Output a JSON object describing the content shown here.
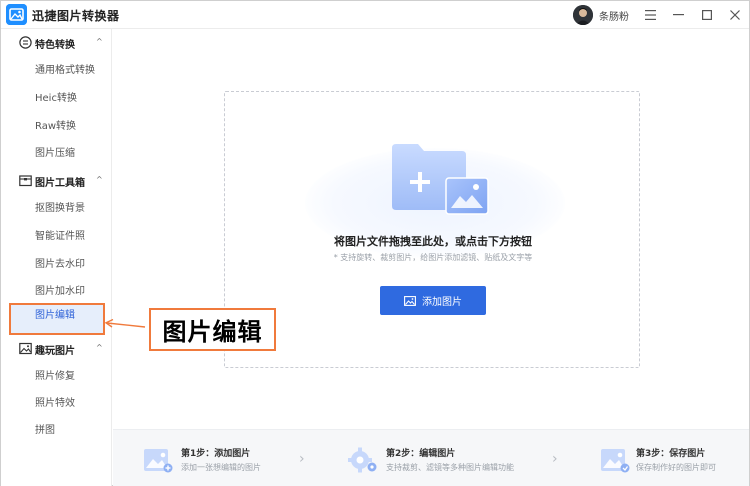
{
  "app": {
    "title": "迅捷图片转换器",
    "username": "条肠粉"
  },
  "window_controls": {
    "menu": "☰",
    "minimize": "—",
    "maximize": "☐",
    "close": "✕"
  },
  "sidebar": {
    "groups": [
      {
        "label": "特色转换",
        "icon": "swap-icon",
        "items": [
          "通用格式转换",
          "Heic转换",
          "Raw转换",
          "图片压缩"
        ]
      },
      {
        "label": "图片工具箱",
        "icon": "toolbox-icon",
        "items": [
          "抠图换背景",
          "智能证件照",
          "图片去水印",
          "图片加水印",
          "图片编辑"
        ]
      },
      {
        "label": "趣玩图片",
        "icon": "image-icon",
        "items": [
          "照片修复",
          "照片特效",
          "拼图"
        ]
      }
    ],
    "active_item": "图片编辑"
  },
  "dropzone": {
    "title": "将图片文件拖拽至此处，或点击下方按钮",
    "subtitle": "* 支持旋转、裁剪图片，给图片添加滤镜、贴纸及文字等",
    "button_label": "添加图片"
  },
  "steps": [
    {
      "title": "第1步：添加图片",
      "desc": "添加一张想编辑的图片"
    },
    {
      "title": "第2步：编辑图片",
      "desc": "支持裁剪、滤镜等多种图片编辑功能"
    },
    {
      "title": "第3步：保存图片",
      "desc": "保存制作好的图片即可"
    }
  ],
  "annotation": {
    "label": "图片编辑"
  },
  "colors": {
    "accent": "#2f6ae0",
    "highlight": "#f07a3c",
    "active_bg": "#e6eefb"
  }
}
